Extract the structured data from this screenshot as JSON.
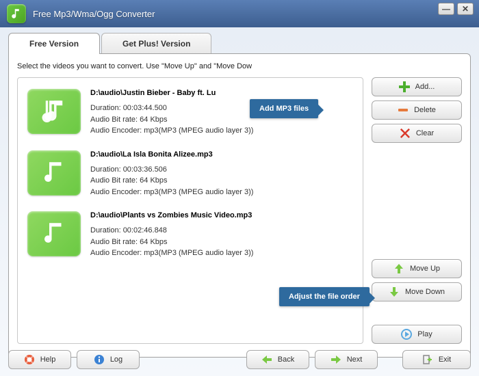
{
  "title": "Free Mp3/Wma/Ogg Converter",
  "tabs": {
    "free": "Free Version",
    "plus": "Get Plus! Version"
  },
  "instruction": "Select the videos you want to convert. Use \"Move Up\" and \"Move Dow",
  "callouts": {
    "add": "Add MP3 files",
    "order": "Adjust the file order"
  },
  "files": [
    {
      "name": "D:\\audio\\Justin Bieber - Baby ft. Lu",
      "duration": "Duration: 00:03:44.500",
      "bitrate": "Audio Bit rate: 64 Kbps",
      "encoder": "Audio Encoder: mp3(MP3 (MPEG audio layer 3))"
    },
    {
      "name": "D:\\audio\\La Isla Bonita Alizee.mp3",
      "duration": "Duration: 00:03:36.506",
      "bitrate": "Audio Bit rate: 64 Kbps",
      "encoder": "Audio Encoder: mp3(MP3 (MPEG audio layer 3))"
    },
    {
      "name": "D:\\audio\\Plants vs Zombies Music Video.mp3",
      "duration": "Duration: 00:02:46.848",
      "bitrate": "Audio Bit rate: 64 Kbps",
      "encoder": "Audio Encoder: mp3(MP3 (MPEG audio layer 3))"
    }
  ],
  "buttons": {
    "add": "Add...",
    "delete": "Delete",
    "clear": "Clear",
    "moveup": "Move Up",
    "movedown": "Move Down",
    "play": "Play",
    "help": "Help",
    "log": "Log",
    "back": "Back",
    "next": "Next",
    "exit": "Exit"
  }
}
